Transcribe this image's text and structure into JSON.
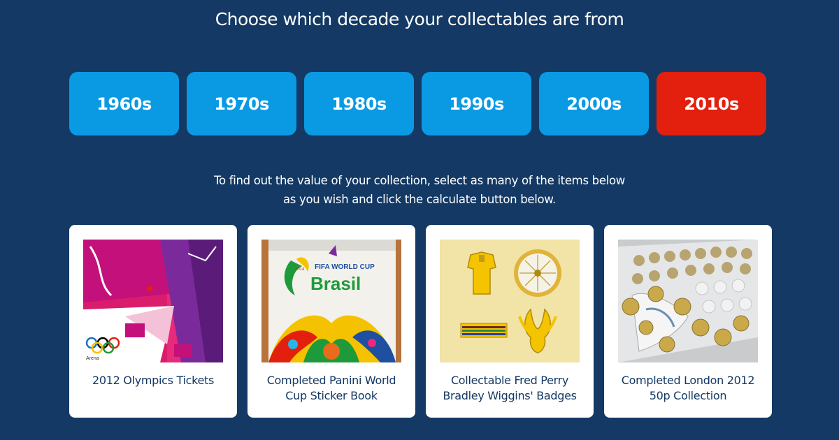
{
  "page": {
    "title": "Choose which decade your collectables are from",
    "instructions_line1": "To find out the value of your collection, select as many of the items below",
    "instructions_line2": "as you wish and click the calculate button below."
  },
  "decades": [
    {
      "label": "1960s",
      "selected": false
    },
    {
      "label": "1970s",
      "selected": false
    },
    {
      "label": "1980s",
      "selected": false
    },
    {
      "label": "1990s",
      "selected": false
    },
    {
      "label": "2000s",
      "selected": false
    },
    {
      "label": "2010s",
      "selected": true
    }
  ],
  "colors": {
    "background": "#133964",
    "decade_button": "#0a9ae4",
    "decade_selected": "#e31f0e",
    "card_text": "#133964"
  },
  "items": [
    {
      "label_line1": "2012 Olympics Tickets",
      "label_line2": "",
      "image": "olympics-tickets-photo",
      "image_text": "Arena"
    },
    {
      "label_line1": "Completed Panini World",
      "label_line2": "Cup Sticker Book",
      "image": "panini-sticker-book-photo",
      "image_text": "FIFA WORLD CUP",
      "image_text2": "Brasil",
      "image_text3": "2014"
    },
    {
      "label_line1": "Collectable Fred Perry",
      "label_line2": "Bradley Wiggins' Badges",
      "image": "fred-perry-badges-photo"
    },
    {
      "label_line1": "Completed London 2012",
      "label_line2": "50p Collection",
      "image": "coin-collection-photo"
    }
  ]
}
